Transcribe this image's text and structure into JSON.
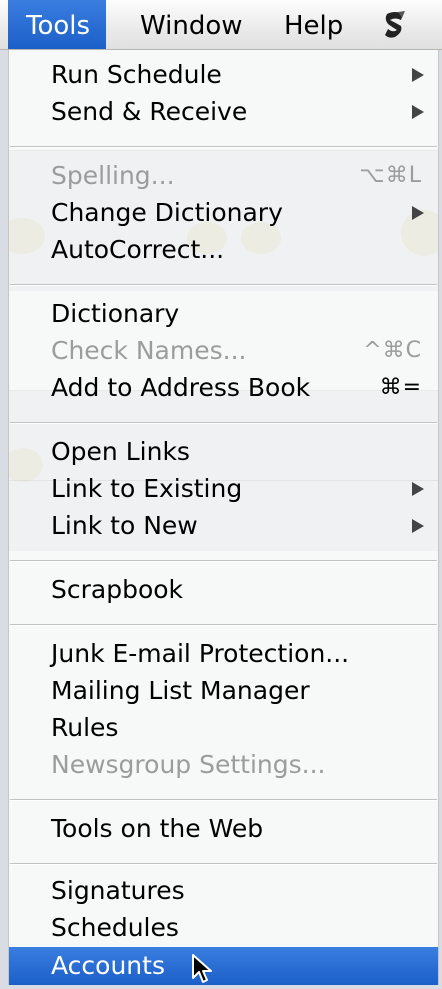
{
  "menubar": {
    "tools": "Tools",
    "window": "Window",
    "help": "Help",
    "script_icon": "script-menu-icon"
  },
  "colors": {
    "highlight": "#1b5fc9",
    "disabled_text": "#9c9c9c",
    "menu_background": "#fafafa"
  },
  "menu": {
    "run_schedule": "Run Schedule",
    "send_receive": "Send & Receive",
    "spelling": "Spelling...",
    "spelling_shortcut": "⌥⌘L",
    "change_dictionary": "Change Dictionary",
    "autocorrect": "AutoCorrect...",
    "dictionary": "Dictionary",
    "check_names": "Check Names...",
    "check_names_shortcut": "^⌘C",
    "add_to_address_book": "Add to Address Book",
    "add_to_address_book_shortcut": "⌘=",
    "open_links": "Open Links",
    "link_to_existing": "Link to Existing",
    "link_to_new": "Link to New",
    "scrapbook": "Scrapbook",
    "junk_email_protection": "Junk E-mail Protection...",
    "mailing_list_manager": "Mailing List Manager",
    "rules": "Rules",
    "newsgroup_settings": "Newsgroup Settings...",
    "tools_on_the_web": "Tools on the Web",
    "signatures": "Signatures",
    "schedules": "Schedules",
    "accounts": "Accounts"
  },
  "cursor_icon": "arrow-cursor-icon"
}
